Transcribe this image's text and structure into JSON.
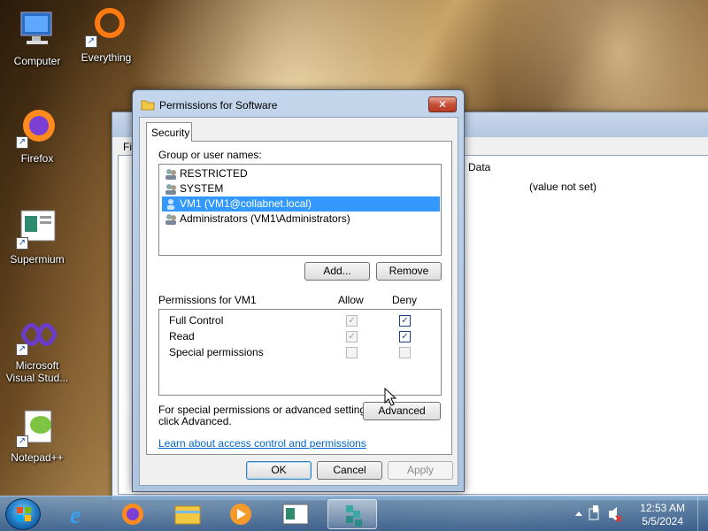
{
  "desktop": {
    "icons": [
      {
        "label": "Computer"
      },
      {
        "label": "Everything"
      },
      {
        "label": "Firefox"
      },
      {
        "label": "Supermium"
      },
      {
        "label": "Microsoft Visual Stud..."
      },
      {
        "label": "Notepad++"
      }
    ]
  },
  "background_window": {
    "menu_fragment": "Fi",
    "column_header": "Data",
    "cell_value": "(value not set)"
  },
  "dialog": {
    "title": "Permissions for Software",
    "close_label": "✕",
    "tab": "Security",
    "group_label": "Group or user names:",
    "users": [
      {
        "name": "RESTRICTED",
        "selected": false
      },
      {
        "name": "SYSTEM",
        "selected": false
      },
      {
        "name": "VM1 (VM1@collabnet.local)",
        "selected": true
      },
      {
        "name": "Administrators (VM1\\Administrators)",
        "selected": false
      }
    ],
    "add_label": "Add...",
    "remove_label": "Remove",
    "permissions_for": "Permissions for VM1",
    "allow_header": "Allow",
    "deny_header": "Deny",
    "permissions": [
      {
        "name": "Full Control",
        "allow": true,
        "allow_disabled": true,
        "deny": true
      },
      {
        "name": "Read",
        "allow": true,
        "allow_disabled": true,
        "deny": true
      },
      {
        "name": "Special permissions",
        "allow": false,
        "allow_disabled": true,
        "deny": false
      }
    ],
    "special_text_1": "For special permissions or advanced settings,",
    "special_text_2": "click Advanced.",
    "advanced_label": "Advanced",
    "link_text": "Learn about access control and permissions",
    "ok_label": "OK",
    "cancel_label": "Cancel",
    "apply_label": "Apply"
  },
  "taskbar": {
    "pinned": [
      "internet-explorer-icon",
      "firefox-icon",
      "file-explorer-icon",
      "media-player-icon",
      "supermium-icon",
      "registry-editor-icon"
    ],
    "clock_time": "12:53 AM",
    "clock_date": "5/5/2024"
  }
}
